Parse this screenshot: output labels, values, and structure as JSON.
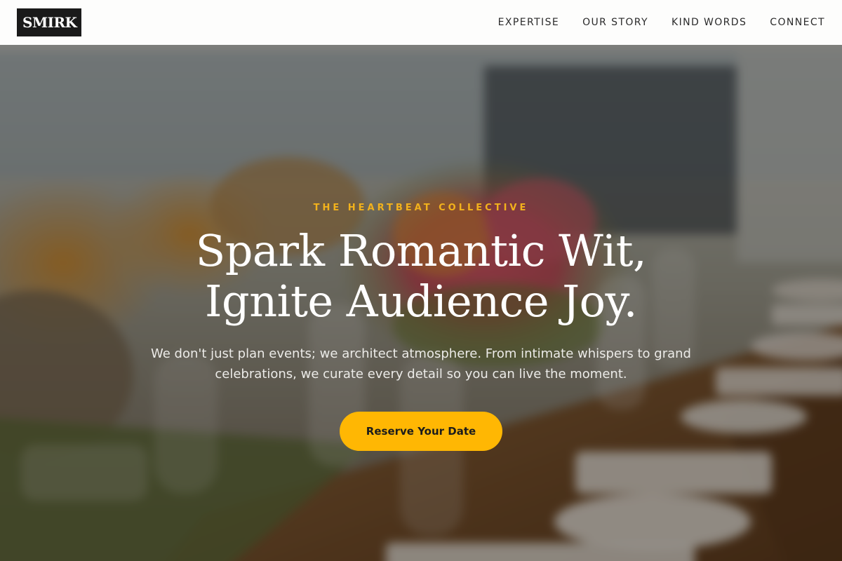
{
  "header": {
    "logo_text": "SMIRK",
    "nav": [
      {
        "label": "EXPERTISE"
      },
      {
        "label": "OUR STORY"
      },
      {
        "label": "KIND WORDS"
      },
      {
        "label": "CONNECT"
      }
    ]
  },
  "hero": {
    "eyebrow": "THE HEARTBEAT COLLECTIVE",
    "headline_line1": "Spark Romantic Wit,",
    "headline_line2": "Ignite Audience Joy.",
    "lede": "We don't just plan events; we architect atmosphere. From intimate whispers to grand celebrations, we curate every detail so you can live the moment.",
    "cta_label": "Reserve Your Date",
    "background_image": "blurred-banquet-table-photo"
  },
  "colors": {
    "accent": "#ffb703",
    "eyebrow": "#f2b21c",
    "header_bg": "#fdfdfc",
    "logo_bg": "#1a1a1a"
  }
}
